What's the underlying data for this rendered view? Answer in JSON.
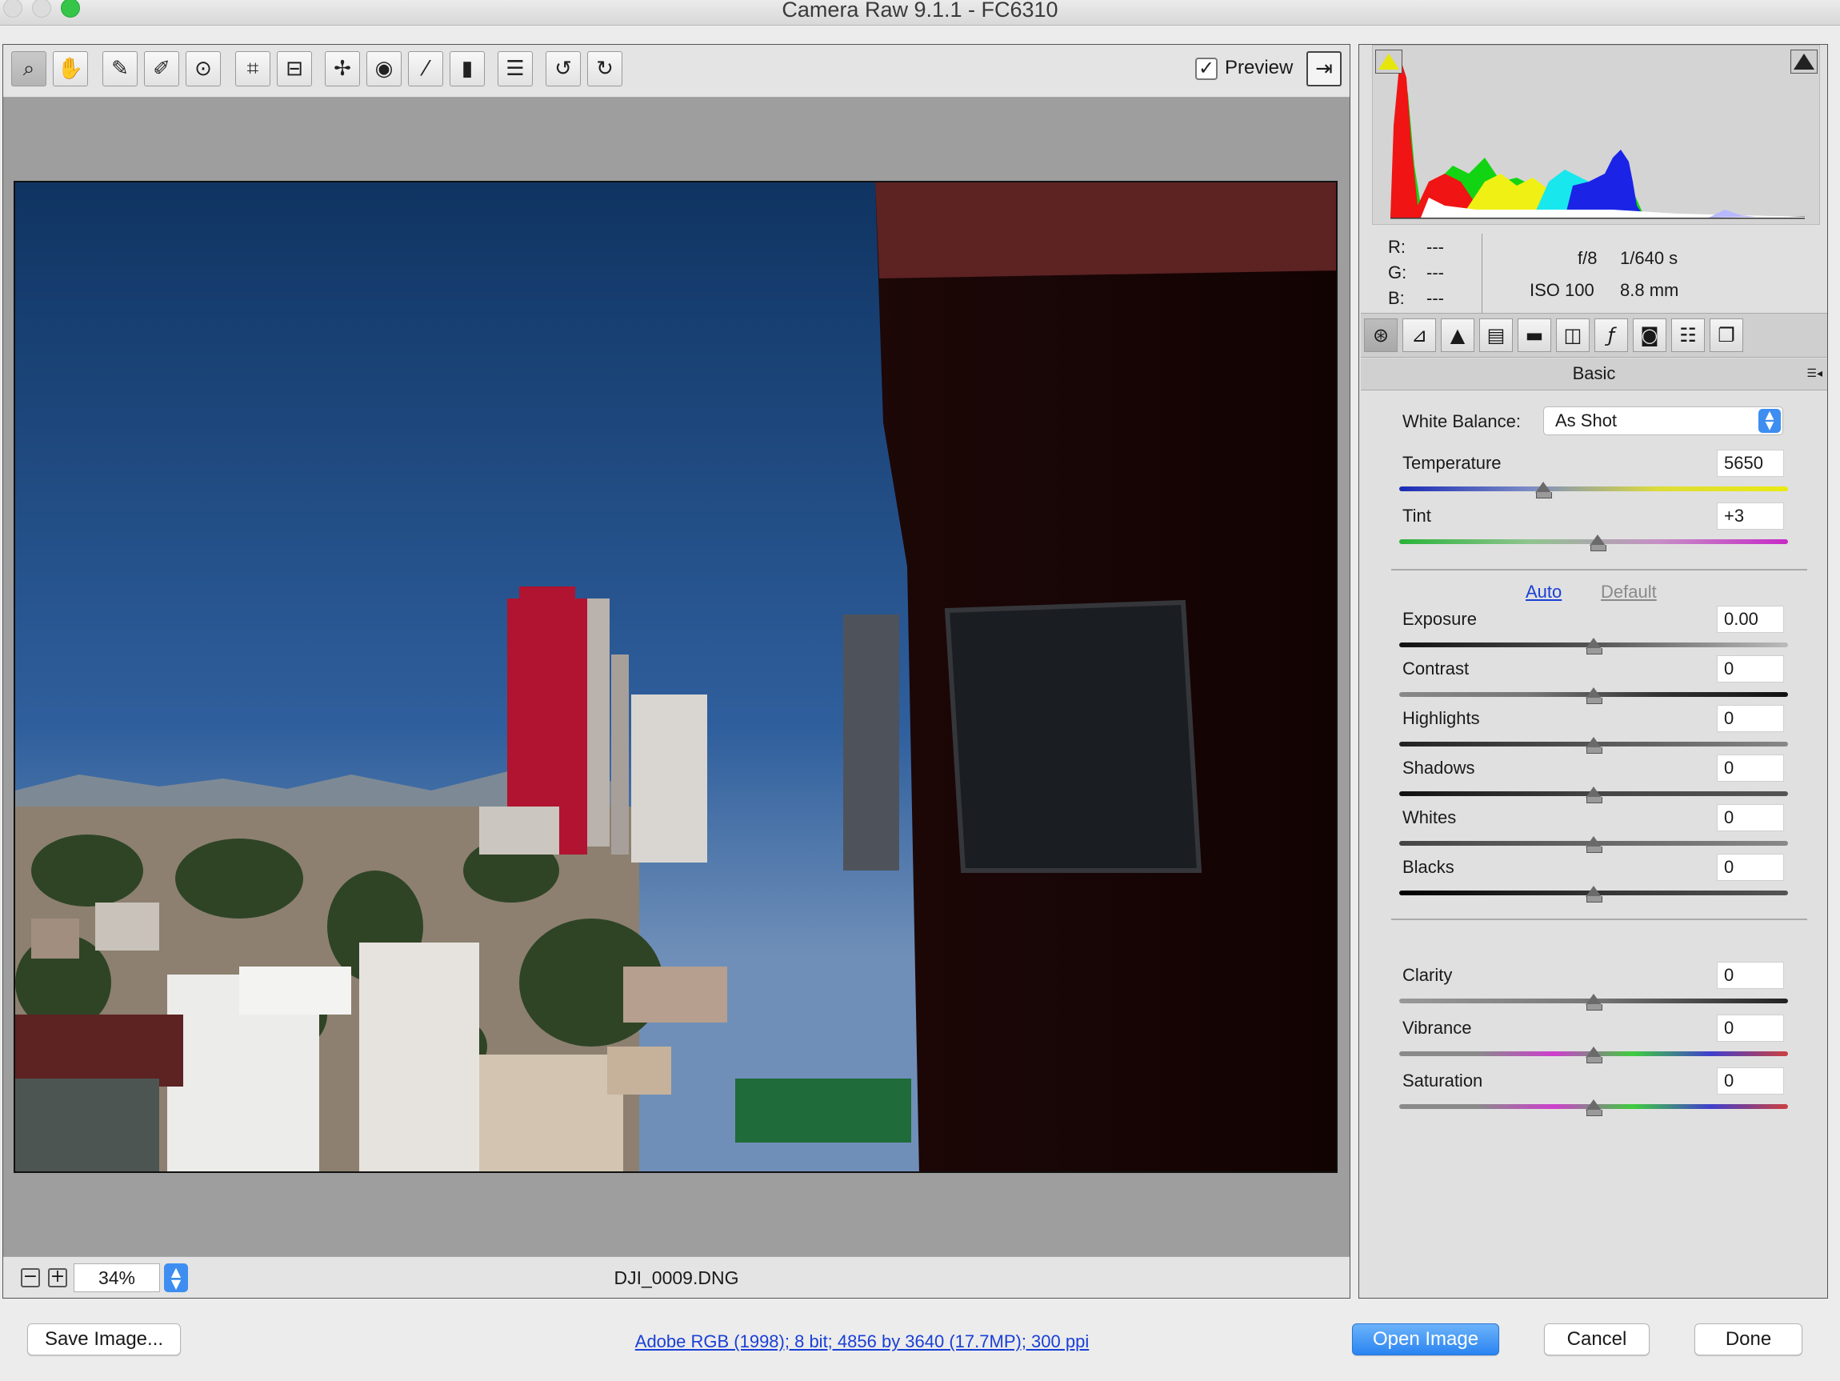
{
  "window": {
    "title": "Camera Raw 9.1.1  -  FC6310"
  },
  "toolbar": {
    "tools": [
      "zoom-tool-icon",
      "hand-tool-icon",
      "white-balance-tool-icon",
      "color-sampler-icon",
      "targeted-adjustment-icon",
      "crop-tool-icon",
      "straighten-tool-icon",
      "spot-removal-icon",
      "red-eye-icon",
      "adjustment-brush-icon",
      "graduated-filter-icon",
      "preferences-icon",
      "rotate-ccw-icon",
      "rotate-cw-icon"
    ],
    "preview_label": "Preview",
    "preview_checked": true
  },
  "canvas": {
    "zoom": "34%",
    "filename": "DJI_0009.DNG"
  },
  "info": {
    "r_label": "R:",
    "r_value": "---",
    "g_label": "G:",
    "g_value": "---",
    "b_label": "B:",
    "b_value": "---",
    "aperture": "f/8",
    "shutter": "1/640 s",
    "iso": "ISO 100",
    "focal": "8.8 mm"
  },
  "panel": {
    "title": "Basic",
    "white_balance_label": "White Balance:",
    "white_balance_value": "As Shot",
    "auto_label": "Auto",
    "default_label": "Default",
    "sliders": [
      {
        "label": "Temperature",
        "value": "5650",
        "level": 0.37
      },
      {
        "label": "Tint",
        "value": "+3",
        "level": 0.51
      },
      {
        "label": "Exposure",
        "value": "0.00",
        "level": 0.5
      },
      {
        "label": "Contrast",
        "value": "0",
        "level": 0.5
      },
      {
        "label": "Highlights",
        "value": "0",
        "level": 0.5
      },
      {
        "label": "Shadows",
        "value": "0",
        "level": 0.5
      },
      {
        "label": "Whites",
        "value": "0",
        "level": 0.5
      },
      {
        "label": "Blacks",
        "value": "0",
        "level": 0.5
      },
      {
        "label": "Clarity",
        "value": "0",
        "level": 0.5
      },
      {
        "label": "Vibrance",
        "value": "0",
        "level": 0.5
      },
      {
        "label": "Saturation",
        "value": "0",
        "level": 0.5
      }
    ]
  },
  "footer": {
    "save_label": "Save Image...",
    "workflow": "Adobe RGB (1998); 8 bit; 4856 by 3640 (17.7MP); 300 ppi",
    "open_label": "Open Image",
    "cancel_label": "Cancel",
    "done_label": "Done"
  },
  "colors": {
    "accent": "#2a84f1",
    "link": "#1a3fd6"
  }
}
